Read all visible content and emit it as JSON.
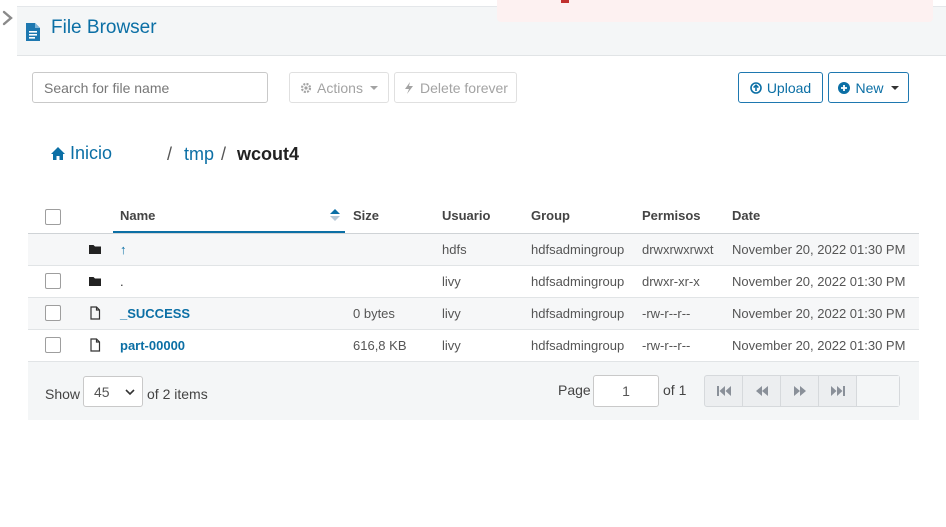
{
  "header": {
    "title": "File Browser"
  },
  "toolbar": {
    "search_placeholder": "Search for file name",
    "actions_label": "Actions",
    "delete_label": "Delete forever",
    "upload_label": "Upload",
    "new_label": "New"
  },
  "breadcrumb": {
    "home": "Inicio",
    "sep": "/",
    "folder": "tmp",
    "current": "wcout4"
  },
  "table": {
    "columns": {
      "name": "Name",
      "size": "Size",
      "user": "Usuario",
      "group": "Group",
      "permissions": "Permisos",
      "date": "Date"
    },
    "rows": [
      {
        "icon": "folder-icon",
        "name": "↑",
        "size": "",
        "user": "hdfs",
        "group": "hdfsadmingroup",
        "permissions": "drwxrwxrwxt",
        "date": "November 20, 2022 01:30 PM"
      },
      {
        "icon": "folder-icon",
        "name": ".",
        "size": "",
        "user": "livy",
        "group": "hdfsadmingroup",
        "permissions": "drwxr-xr-x",
        "date": "November 20, 2022 01:30 PM"
      },
      {
        "icon": "file-icon",
        "name": "_SUCCESS",
        "size": "0 bytes",
        "user": "livy",
        "group": "hdfsadmingroup",
        "permissions": "-rw-r--r--",
        "date": "November 20, 2022 01:30 PM"
      },
      {
        "icon": "file-icon",
        "name": "part-00000",
        "size": "616,8 KB",
        "user": "livy",
        "group": "hdfsadmingroup",
        "permissions": "-rw-r--r--",
        "date": "November 20, 2022 01:30 PM"
      }
    ]
  },
  "pagination": {
    "show_label": "Show",
    "page_size": "45",
    "items_label": "of 2 items",
    "page_label": "Page",
    "page_value": "1",
    "of_pages": "of 1"
  },
  "colors": {
    "accent": "#0b6fa5",
    "toolbar_bg": "#f4f6f7"
  }
}
